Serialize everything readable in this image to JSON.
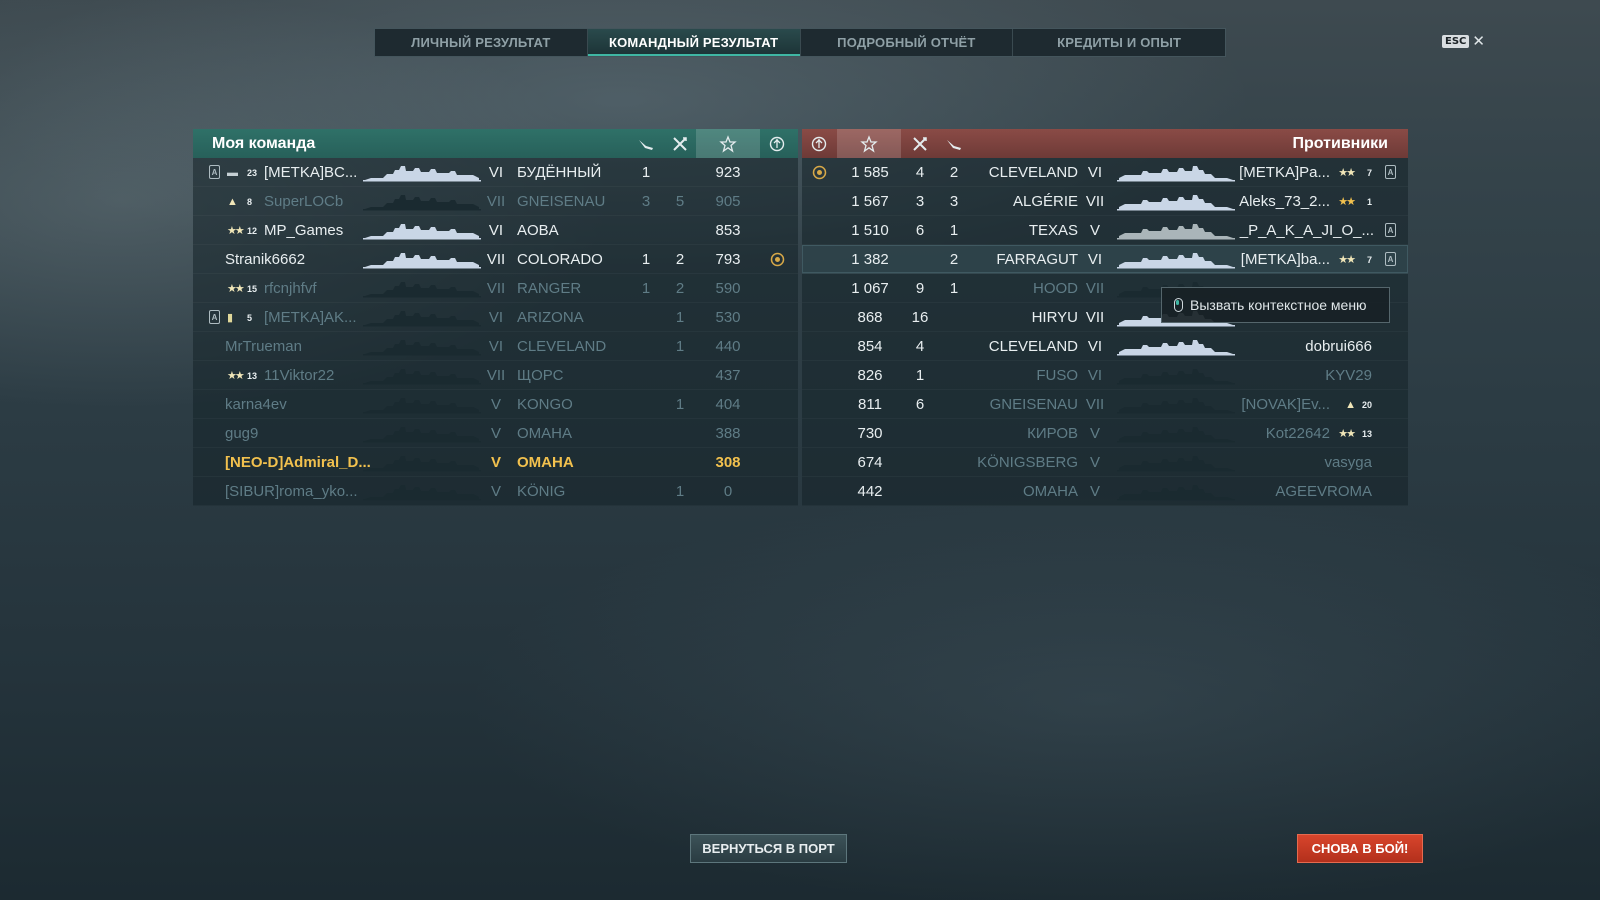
{
  "tabs": [
    {
      "label": "ЛИЧНЫЙ РЕЗУЛЬТАТ",
      "active": false
    },
    {
      "label": "КОМАНДНЫЙ РЕЗУЛЬТАТ",
      "active": true
    },
    {
      "label": "ПОДРОБНЫЙ ОТЧЁТ",
      "active": false
    },
    {
      "label": "КРЕДИТЫ И ОПЫТ",
      "active": false
    }
  ],
  "esc": {
    "key_label": "ESC",
    "close_glyph": "✕"
  },
  "my_team": {
    "title": "Моя команда",
    "columns": [
      "plane-kills-icon",
      "frags-icon",
      "star-icon",
      "achievement-icon"
    ],
    "rows": [
      {
        "player": "[METKA]BC...",
        "rank": "23",
        "rank_style": "bar",
        "clan_icon": true,
        "tier": "VI",
        "ship": "БУДЁННЫЙ",
        "planes": "1",
        "frags": "",
        "xp": "923",
        "medal": false,
        "style": "white"
      },
      {
        "player": "SuperLOCb",
        "rank": "8",
        "rank_style": "stars1",
        "clan_icon": false,
        "tier": "VII",
        "ship": "GNEISENAU",
        "planes": "3",
        "frags": "5",
        "xp": "905",
        "medal": false,
        "style": "dim"
      },
      {
        "player": "MP_Games",
        "rank": "12",
        "rank_style": "stars2",
        "clan_icon": false,
        "tier": "VI",
        "ship": "AOBA",
        "planes": "",
        "frags": "",
        "xp": "853",
        "medal": false,
        "style": "white"
      },
      {
        "player": "Stranik6662",
        "rank": "",
        "rank_style": "none",
        "clan_icon": false,
        "tier": "VII",
        "ship": "COLORADO",
        "planes": "1",
        "frags": "2",
        "xp": "793",
        "medal": true,
        "style": "white"
      },
      {
        "player": "rfcnjhfvf",
        "rank": "15",
        "rank_style": "stars2",
        "clan_icon": false,
        "tier": "VII",
        "ship": "RANGER",
        "planes": "1",
        "frags": "2",
        "xp": "590",
        "medal": false,
        "style": "dim"
      },
      {
        "player": "[METKA]AK...",
        "rank": "5",
        "rank_style": "stripe",
        "clan_icon": true,
        "tier": "VI",
        "ship": "ARIZONA",
        "planes": "",
        "frags": "1",
        "xp": "530",
        "medal": false,
        "style": "dim"
      },
      {
        "player": "MrTrueman",
        "rank": "",
        "rank_style": "none",
        "clan_icon": false,
        "tier": "VI",
        "ship": "CLEVELAND",
        "planes": "",
        "frags": "1",
        "xp": "440",
        "medal": false,
        "style": "dim"
      },
      {
        "player": "11Viktor22",
        "rank": "13",
        "rank_style": "stars2",
        "clan_icon": false,
        "tier": "VII",
        "ship": "ЩОРС",
        "planes": "",
        "frags": "",
        "xp": "437",
        "medal": false,
        "style": "dim"
      },
      {
        "player": "karna4ev",
        "rank": "",
        "rank_style": "none",
        "clan_icon": false,
        "tier": "V",
        "ship": "KONGO",
        "planes": "",
        "frags": "1",
        "xp": "404",
        "medal": false,
        "style": "dim"
      },
      {
        "player": "gug9",
        "rank": "",
        "rank_style": "none",
        "clan_icon": false,
        "tier": "V",
        "ship": "OMAHA",
        "planes": "",
        "frags": "",
        "xp": "388",
        "medal": false,
        "style": "dim"
      },
      {
        "player": "[NEO-D]Admiral_D...",
        "rank": "",
        "rank_style": "none",
        "clan_icon": false,
        "tier": "V",
        "ship": "OMAHA",
        "planes": "",
        "frags": "",
        "xp": "308",
        "medal": false,
        "style": "gold"
      },
      {
        "player": "[SIBUR]roma_yko...",
        "rank": "",
        "rank_style": "none",
        "clan_icon": false,
        "tier": "V",
        "ship": "KÖNIG",
        "planes": "",
        "frags": "1",
        "xp": "0",
        "medal": false,
        "style": "dim"
      }
    ]
  },
  "enemy_team": {
    "title": "Противники",
    "rows": [
      {
        "player": "[METKA]Pa...",
        "rank": "7",
        "rank_style": "stars2",
        "clan_icon": true,
        "tier": "VI",
        "ship": "CLEVELAND",
        "planes": "2",
        "frags": "4",
        "xp": "1 585",
        "medal": true,
        "style": "white",
        "ship_style": "light"
      },
      {
        "player": "Aleks_73_2...",
        "rank": "1",
        "rank_style": "gold",
        "clan_icon": false,
        "tier": "VII",
        "ship": "ALGÉRIE",
        "planes": "3",
        "frags": "3",
        "xp": "1 567",
        "medal": false,
        "style": "white",
        "ship_style": "light"
      },
      {
        "player": "_P_A_K_A_JI_O_...",
        "rank": "",
        "rank_style": "none",
        "clan_icon": true,
        "tier": "V",
        "ship": "TEXAS",
        "planes": "1",
        "frags": "6",
        "xp": "1 510",
        "medal": false,
        "style": "white",
        "ship_style": "grey"
      },
      {
        "player": "[METKA]ba...",
        "rank": "7",
        "rank_style": "stars2",
        "clan_icon": true,
        "tier": "VI",
        "ship": "FARRAGUT",
        "planes": "2",
        "frags": "",
        "xp": "1 382",
        "medal": false,
        "style": "white",
        "ship_style": "light",
        "highlight": true
      },
      {
        "player": "",
        "rank": "",
        "rank_style": "none",
        "clan_icon": false,
        "tier": "VII",
        "ship": "HOOD",
        "planes": "1",
        "frags": "9",
        "xp": "1 067",
        "medal": false,
        "style": "dim",
        "ship_style": "dark"
      },
      {
        "player": "",
        "rank": "",
        "rank_style": "none",
        "clan_icon": false,
        "tier": "VII",
        "ship": "HIRYU",
        "planes": "",
        "frags": "16",
        "xp": "868",
        "medal": false,
        "style": "white",
        "ship_style": "light"
      },
      {
        "player": "dobrui666",
        "rank": "",
        "rank_style": "none",
        "clan_icon": false,
        "tier": "VI",
        "ship": "CLEVELAND",
        "planes": "",
        "frags": "4",
        "xp": "854",
        "medal": false,
        "style": "white",
        "ship_style": "light"
      },
      {
        "player": "KYV29",
        "rank": "",
        "rank_style": "none",
        "clan_icon": false,
        "tier": "VI",
        "ship": "FUSO",
        "planes": "",
        "frags": "1",
        "xp": "826",
        "medal": false,
        "style": "dim",
        "ship_style": "dark"
      },
      {
        "player": "[NOVAK]Ev...",
        "rank": "20",
        "rank_style": "stars1",
        "clan_icon": false,
        "tier": "VII",
        "ship": "GNEISENAU",
        "planes": "",
        "frags": "6",
        "xp": "811",
        "medal": false,
        "style": "dim",
        "ship_style": "dark"
      },
      {
        "player": "Kot22642",
        "rank": "13",
        "rank_style": "stars2",
        "clan_icon": false,
        "tier": "V",
        "ship": "КИРОВ",
        "planes": "",
        "frags": "",
        "xp": "730",
        "medal": false,
        "style": "dim",
        "ship_style": "dark"
      },
      {
        "player": "vasyga",
        "rank": "",
        "rank_style": "none",
        "clan_icon": false,
        "tier": "V",
        "ship": "KÖNIGSBERG",
        "planes": "",
        "frags": "",
        "xp": "674",
        "medal": false,
        "style": "dim",
        "ship_style": "dark"
      },
      {
        "player": "AGEEVROMA",
        "rank": "",
        "rank_style": "none",
        "clan_icon": false,
        "tier": "V",
        "ship": "OMAHA",
        "planes": "",
        "frags": "",
        "xp": "442",
        "medal": false,
        "style": "dim",
        "ship_style": "dark"
      }
    ]
  },
  "tooltip": {
    "text": "Вызвать контекстное меню"
  },
  "buttons": {
    "port": "ВЕРНУТЬСЯ В ПОРТ",
    "battle": "СНОВА В БОЙ!"
  },
  "colors": {
    "accent": "#3fb7a4",
    "my_team": "#2f7168",
    "enemy_team": "#8a4b46",
    "highlight_player": "#f2c14e",
    "battle_button": "#d8452c"
  }
}
